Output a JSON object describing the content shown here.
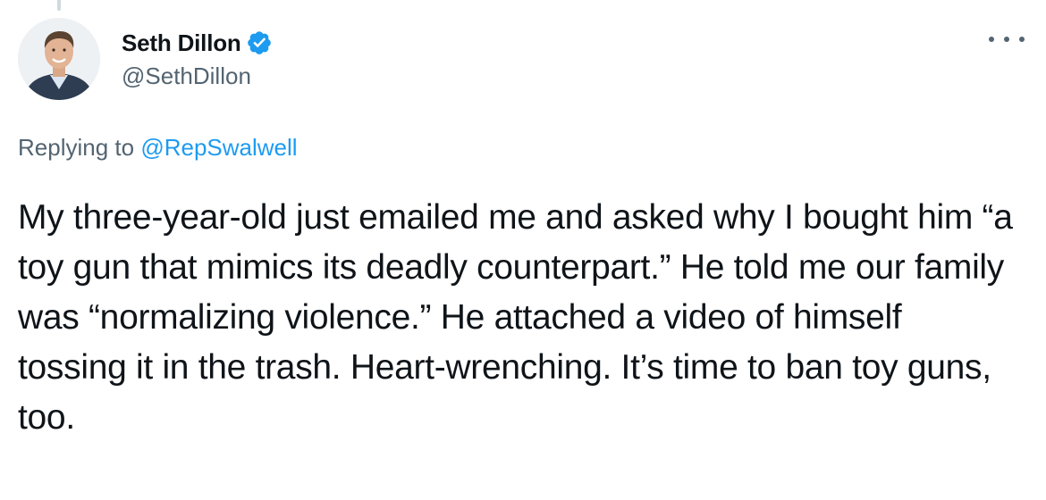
{
  "tweet": {
    "author": {
      "display_name": "Seth Dillon",
      "handle": "@SethDillon",
      "avatar_icon": "profile-photo",
      "verified_icon": "verified-badge-icon",
      "verified_color": "#1d9bf0"
    },
    "more_icon": "more-horizontal-icon",
    "reply_context": {
      "prefix": "Replying to ",
      "mention": "@RepSwalwell"
    },
    "text": "My three-year-old just emailed me and asked why I bought him “a toy gun that mimics its deadly counterpart.” He told me our family was “normalizing violence.” He attached a video of himself tossing it in the trash. Heart-wrenching. It’s time to ban toy guns, too."
  },
  "colors": {
    "text_primary": "#0f1419",
    "text_secondary": "#536471",
    "accent": "#1d9bf0",
    "thread_line": "#cfd9de"
  }
}
